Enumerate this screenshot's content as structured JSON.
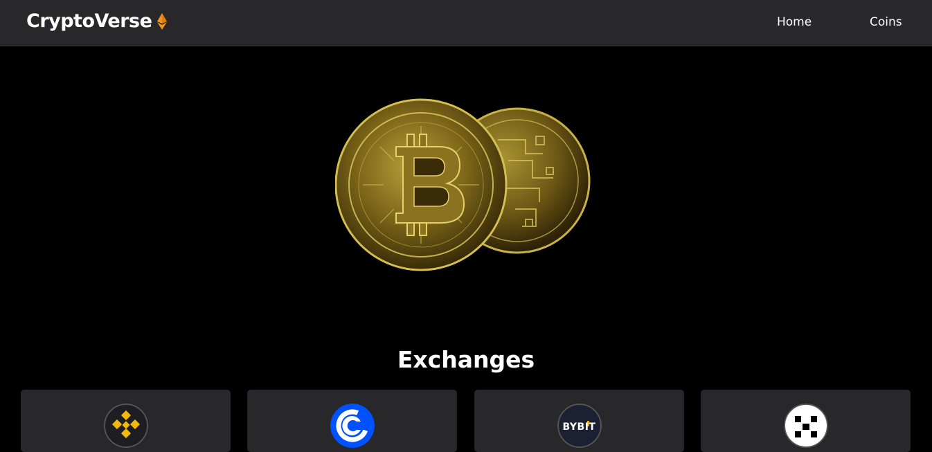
{
  "navbar": {
    "brand": "CryptoVerse",
    "brand_icon": "ethereum-icon",
    "brand_icon_color": "#f7931a",
    "links": [
      {
        "label": "Home"
      },
      {
        "label": "Coins"
      }
    ],
    "background": "#28282b"
  },
  "hero": {
    "image": "bitcoin-coins-image"
  },
  "exchanges": {
    "title": "Exchanges",
    "cards": [
      {
        "name": "binance",
        "logo_icon": "binance-icon"
      },
      {
        "name": "coinbase",
        "logo_icon": "coinbase-icon"
      },
      {
        "name": "bybit",
        "logo_icon": "bybit-icon",
        "logo_text": "BYBIT"
      },
      {
        "name": "okx",
        "logo_icon": "okx-icon"
      }
    ]
  }
}
